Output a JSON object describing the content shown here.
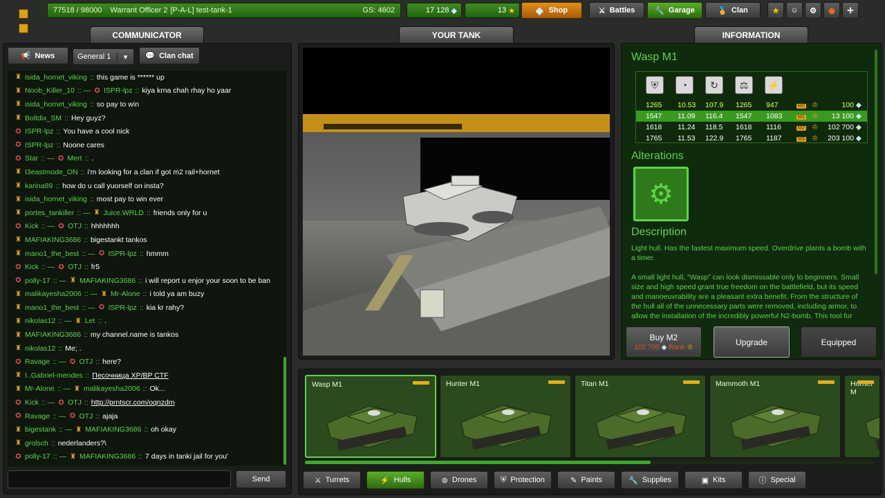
{
  "topbar": {
    "xp": "77518 / 98000",
    "rank_name": "Warrant Officer 2",
    "player": "[P-A-L] test-tank-1",
    "gs": "GS: 4602",
    "crystals": "17 128",
    "stars": "13",
    "shop": "Shop",
    "battles": "Battles",
    "garage": "Garage",
    "clan": "Clan"
  },
  "communicator": {
    "title": "COMMUNICATOR",
    "news": "News",
    "channel": "General 1",
    "clan_chat": "Clan chat",
    "send": "Send",
    "input_value": ""
  },
  "messages": [
    {
      "n": "isida_hornet_viking",
      "t": "this game is ****** up",
      "r": 1
    },
    {
      "n": "Noob_Killer_10",
      "to": "ISPR-lpz",
      "t": "kiya krna chah rhay ho yaar",
      "r": 1,
      "r2": 2
    },
    {
      "n": "isida_hornet_viking",
      "t": "so pay to win",
      "r": 1
    },
    {
      "n": "Boltdix_SM",
      "t": "Hey guyz?",
      "r": 1
    },
    {
      "n": "ISPR-lpz",
      "t": "You have a cool nick",
      "r": 2
    },
    {
      "n": "ISPR-lpz",
      "t": "Noone cares",
      "r": 2
    },
    {
      "n": "Star",
      "to": "Mert",
      "t": ".",
      "r": 2,
      "r2": 2
    },
    {
      "n": "I3eastmode_ON",
      "t": "i'm looking for a clan if got m2 rail+hornet",
      "r": 1
    },
    {
      "n": "karina89",
      "t": "how do u call yuorself on insta?",
      "r": 1
    },
    {
      "n": "isida_hornet_viking",
      "t": "most pay to win ever",
      "r": 1
    },
    {
      "n": "portes_tankiller",
      "to": "Juice.WRLD",
      "t": "friends only for u",
      "r": 1,
      "r2": 1
    },
    {
      "n": "Kick",
      "to": "OTJ",
      "t": "hhhhhhh",
      "r": 2,
      "r2": 2
    },
    {
      "n": "MAFIAKING3686",
      "t": "bigestankt tankos",
      "r": 1
    },
    {
      "n": "mano1_the_best",
      "to": "ISPR-lpz",
      "t": "hmmm",
      "r": 1,
      "r2": 2
    },
    {
      "n": "Kick",
      "to": "OTJ",
      "t": "fr5",
      "r": 2,
      "r2": 2
    },
    {
      "n": "polly-17",
      "to": "MAFIAKING3686",
      "t": "i will report u enjor your soon to be ban",
      "r": 2,
      "r2": 1
    },
    {
      "n": "malikayesha2006",
      "to": "Mr-Alone",
      "t": "i told ya am buzy",
      "r": 1,
      "r2": 1
    },
    {
      "n": "mano1_the_best",
      "to": "ISPR-lpz",
      "t": "kia kr rahy?",
      "r": 1,
      "r2": 2
    },
    {
      "n": "nikolas12",
      "to": "Let",
      "t": ".",
      "r": 1,
      "r2": 1
    },
    {
      "n": "MAFIAKING3686",
      "t": "my channel.name is tankos",
      "r": 1
    },
    {
      "n": "nikolas12",
      "t": "Me; .",
      "r": 1
    },
    {
      "n": "Ravage",
      "to": "OTJ",
      "t": "here?",
      "r": 2,
      "r2": 2
    },
    {
      "n": "I..Gabriel-mendes",
      "t": "Песочница XP/BP CTF",
      "r": 1,
      "u": true
    },
    {
      "n": "Mr-Alone",
      "to": "malikayesha2006",
      "t": "Ok...",
      "r": 1,
      "r2": 1
    },
    {
      "n": "Kick",
      "to": "OTJ",
      "t": "http://prntscr.com/oqnzdm",
      "r": 2,
      "r2": 2,
      "u": true
    },
    {
      "n": "Ravage",
      "to": "OTJ",
      "t": "ajaja",
      "r": 2,
      "r2": 2
    },
    {
      "n": "bigestank",
      "to": "MAFIAKING3686",
      "t": "oh okay",
      "r": 1,
      "r2": 1
    },
    {
      "n": "grolsch",
      "t": "nederlanders?\\",
      "r": 1
    },
    {
      "n": "polly-17",
      "to": "MAFIAKING3686",
      "t": "7 days in tanki jail for you'",
      "r": 2,
      "r2": 1
    }
  ],
  "your_tank": {
    "title": "YOUR TANK"
  },
  "info": {
    "title": "INFORMATION",
    "item_name": "Wasp M1",
    "stat_icons": [
      "armor-icon",
      "speed-icon",
      "turn-icon",
      "weight-icon",
      "power-icon"
    ],
    "rows": [
      {
        "v": [
          "1265",
          "10.53",
          "107.9",
          "1265",
          "947"
        ],
        "mod": "M0",
        "price": "100"
      },
      {
        "v": [
          "1547",
          "11.09",
          "116.4",
          "1547",
          "1083"
        ],
        "mod": "M1",
        "price": "13 100"
      },
      {
        "v": [
          "1618",
          "11.24",
          "118.5",
          "1618",
          "1116"
        ],
        "mod": "M2",
        "price": "102 700"
      },
      {
        "v": [
          "1765",
          "11.53",
          "122.9",
          "1765",
          "1187"
        ],
        "mod": "M3",
        "price": "203 100"
      }
    ],
    "alterations": "Alterations",
    "description_title": "Description",
    "desc1": "Light hull. Has the fastest maximum speed. Overdrive plants a bomb with a timer.",
    "desc2": "A small light hull, “Wasp” can look dismissable only to beginners. Small size and high speed grant true freedom on the battlefield, but its speed and manoeuvrability are a pleasant extra benefit. From the structure of the hull all of the unnecessary parts were removed, including armor, to allow the installation of the incredibly powerful N2-bomb. This tool for",
    "buy_label": "Buy M2",
    "buy_price": "102 700",
    "buy_rank": "Rank",
    "upgrade": "Upgrade",
    "equipped": "Equipped"
  },
  "garage_items": [
    "Wasp M1",
    "Hunter M1",
    "Titan M1",
    "Mammoth M1",
    "Hornet M"
  ],
  "categories": [
    "Turrets",
    "Hulls",
    "Drones",
    "Protection",
    "Paints",
    "Supplies",
    "Kits",
    "Special"
  ],
  "colors": {
    "accent_green": "#5fd34a",
    "xp_bar": "#2f7a18",
    "shop_orange": "#d88418",
    "selected_row": "#3a9a20"
  }
}
